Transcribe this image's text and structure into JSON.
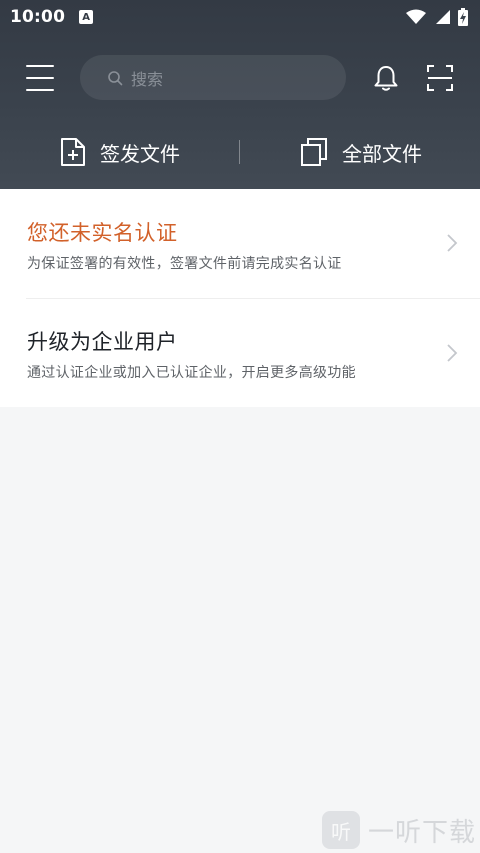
{
  "status_bar": {
    "time": "10:00",
    "notification_icon": "A",
    "icons": [
      "wifi-icon",
      "signal-icon",
      "battery-icon"
    ]
  },
  "header": {
    "search": {
      "placeholder": "搜索"
    },
    "actions": {
      "issue_label": "签发文件",
      "all_label": "全部文件"
    }
  },
  "cards": {
    "verify": {
      "title": "您还未实名认证",
      "desc": "为保证签署的有效性，签署文件前请完成实名认证",
      "title_color": "#d2612a"
    },
    "upgrade": {
      "title": "升级为企业用户",
      "desc": "通过认证企业或加入已认证企业，开启更多高级功能"
    }
  },
  "watermark": {
    "logo_text": "听",
    "text": "一听下载"
  }
}
